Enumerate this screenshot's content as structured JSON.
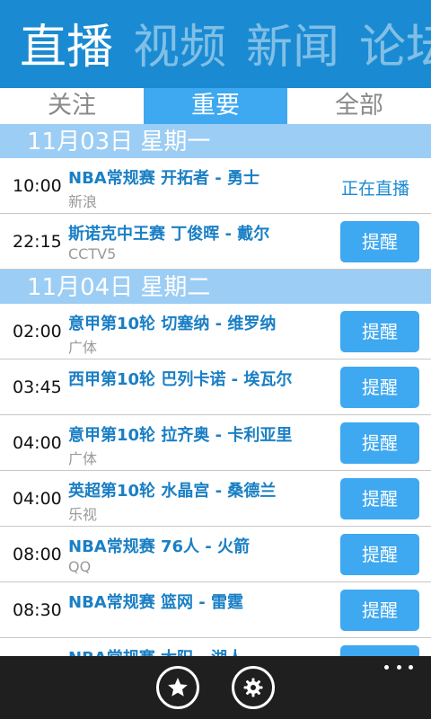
{
  "header": {
    "pivots": [
      "直播",
      "视频",
      "新闻",
      "论坛"
    ]
  },
  "tabs": [
    "关注",
    "重要",
    "全部"
  ],
  "days": [
    {
      "date": "11月03日 星期一",
      "matches": [
        {
          "time": "10:00",
          "title": "NBA常规赛 开拓者 - 勇士",
          "channel": "新浪",
          "action": "正在直播"
        },
        {
          "time": "22:15",
          "title": "斯诺克中王赛 丁俊晖 - 戴尔",
          "channel": "CCTV5",
          "action": "提醒"
        }
      ]
    },
    {
      "date": "11月04日 星期二",
      "matches": [
        {
          "time": "02:00",
          "title": "意甲第10轮 切塞纳 - 维罗纳",
          "channel": "广体",
          "action": "提醒"
        },
        {
          "time": "03:45",
          "title": "西甲第10轮 巴列卡诺 - 埃瓦尔",
          "channel": "",
          "action": "提醒"
        },
        {
          "time": "04:00",
          "title": "意甲第10轮 拉齐奥 - 卡利亚里",
          "channel": "广体",
          "action": "提醒"
        },
        {
          "time": "04:00",
          "title": "英超第10轮 水晶宫 - 桑德兰",
          "channel": "乐视",
          "action": "提醒"
        },
        {
          "time": "08:00",
          "title": "NBA常规赛 76人 - 火箭",
          "channel": "QQ",
          "action": "提醒"
        },
        {
          "time": "08:30",
          "title": "NBA常规赛 篮网 - 雷霆",
          "channel": "",
          "action": "提醒"
        },
        {
          "time": "",
          "title": "NBA常规赛 太阳 - 湖人",
          "channel": "",
          "action": "提醒"
        }
      ]
    }
  ],
  "appbar": {
    "icons": [
      "star-icon",
      "gear-icon",
      "more-icon"
    ]
  },
  "colors": {
    "header_bg": "#1a8bd2",
    "accent": "#3ea8f1",
    "day_header_bg": "#9ccdf4",
    "title_text": "#1a7fc4",
    "appbar_bg": "#1f1f1f"
  }
}
